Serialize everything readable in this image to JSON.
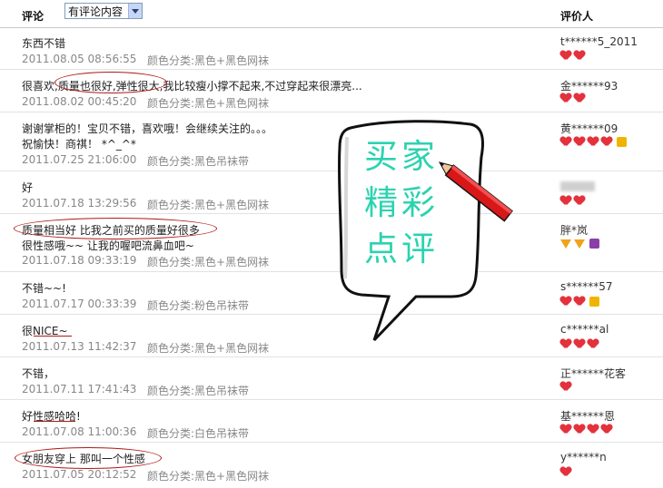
{
  "header": {
    "comment_label": "评论",
    "filter_selected": "有评论内容",
    "reviewer_label": "评价人"
  },
  "rows": [
    {
      "text": "东西不错",
      "text2": "",
      "date": "2011.08.05 08:56:55",
      "color": "颜色分类:黑色+黑色网袜",
      "user": "t******5_2011",
      "rank": "hearts2"
    },
    {
      "text": "很喜欢,质量也很好,弹性很大,我比较瘦小撑不起来,不过穿起来很漂亮...",
      "text2": "",
      "date": "2011.08.02 00:45:20",
      "color": "颜色分类:黑色+黑色网袜",
      "user": "金******93",
      "rank": "hearts2"
    },
    {
      "text": "谢谢掌柜的！宝贝不错，喜欢哦！会继续关注的。。。",
      "text2": "祝愉快！商祺！ *^_^*",
      "date": "2011.07.25 21:06:00",
      "color": "颜色分类:黑色吊袜带",
      "user": "黄******09",
      "rank": "hearts4gold"
    },
    {
      "text": "好",
      "text2": "",
      "date": "2011.07.18 13:29:56",
      "color": "颜色分类:黑色+黑色网袜",
      "user": "",
      "rank": "hearts2"
    },
    {
      "text": "质量相当好 比我之前买的质量好很多",
      "text2": "很性感哦~~ 让我的喔吧流鼻血吧~",
      "date": "2011.07.18 09:33:19",
      "color": "颜色分类:黑色+黑色网袜",
      "user": "胖*岚",
      "rank": "diamonds2purple"
    },
    {
      "text": "不错~~!",
      "text2": "",
      "date": "2011.07.17 00:33:39",
      "color": "颜色分类:粉色吊袜带",
      "user": "s******57",
      "rank": "hearts2gold"
    },
    {
      "text": "很NICE~",
      "text2": "",
      "date": "2011.07.13 11:42:37",
      "color": "颜色分类:黑色+黑色网袜",
      "user": "c******al",
      "rank": "hearts3"
    },
    {
      "text": "不错，",
      "text2": "",
      "date": "2011.07.11 17:41:43",
      "color": "颜色分类:黑色吊袜带",
      "user": "正******花客",
      "rank": "hearts1"
    },
    {
      "text": "好性感哈哈!",
      "text2": "",
      "date": "2011.07.08 11:00:36",
      "color": "颜色分类:白色吊袜带",
      "user": "基******恩",
      "rank": "hearts4"
    },
    {
      "text": "女朋友穿上 那叫一个性感",
      "text2": "",
      "date": "2011.07.05 20:12:52",
      "color": "颜色分类:黑色+黑色网袜",
      "user": "y******n",
      "rank": "hearts1"
    }
  ],
  "bubble": {
    "line1": "买家",
    "line2": "精彩",
    "line3": "点评"
  }
}
